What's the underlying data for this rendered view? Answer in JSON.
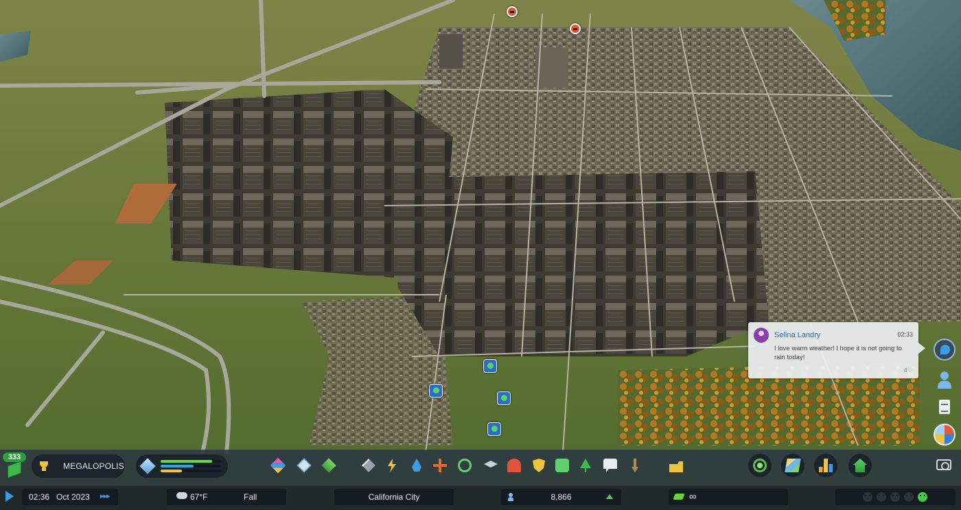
{
  "chirp": {
    "author": "Selina Landry",
    "time": "02:33",
    "message": "I love warm weather! I hope it is not going to rain today!",
    "likes": "4"
  },
  "milestone": {
    "xp": "333",
    "name": "MEGALOPOLIS",
    "progress": [
      0.85,
      0.55,
      0.35
    ],
    "progress_colors": [
      "#6ad84a",
      "#2ea6e0",
      "#f2c534"
    ]
  },
  "toolbar_icons": [
    "zoning-icon",
    "area-icon",
    "landscaping-icon",
    "roads-icon",
    "electricity-icon",
    "water-icon",
    "health-icon",
    "garbage-icon",
    "education-icon",
    "fire-icon",
    "police-icon",
    "transportation-icon",
    "parks-icon",
    "communications-icon",
    "landmarks-icon",
    "bulldozer-icon"
  ],
  "right_tools": [
    "economy-icon",
    "city-map-icon",
    "statistics-icon",
    "city-services-icon",
    "photo-mode-icon"
  ],
  "time": {
    "clock": "02:36",
    "date": "Oct 2023",
    "speed": "▸▸▸"
  },
  "weather": {
    "temperature": "67°F",
    "season": "Fall"
  },
  "city": {
    "name": "California City"
  },
  "population": {
    "value": "8,866",
    "trend": "up"
  },
  "money": {
    "value": "∞"
  },
  "happiness": {
    "faces": 5,
    "active": 4
  },
  "colors": {
    "accent": "#3f9ae6",
    "positive": "#4ccf57"
  }
}
